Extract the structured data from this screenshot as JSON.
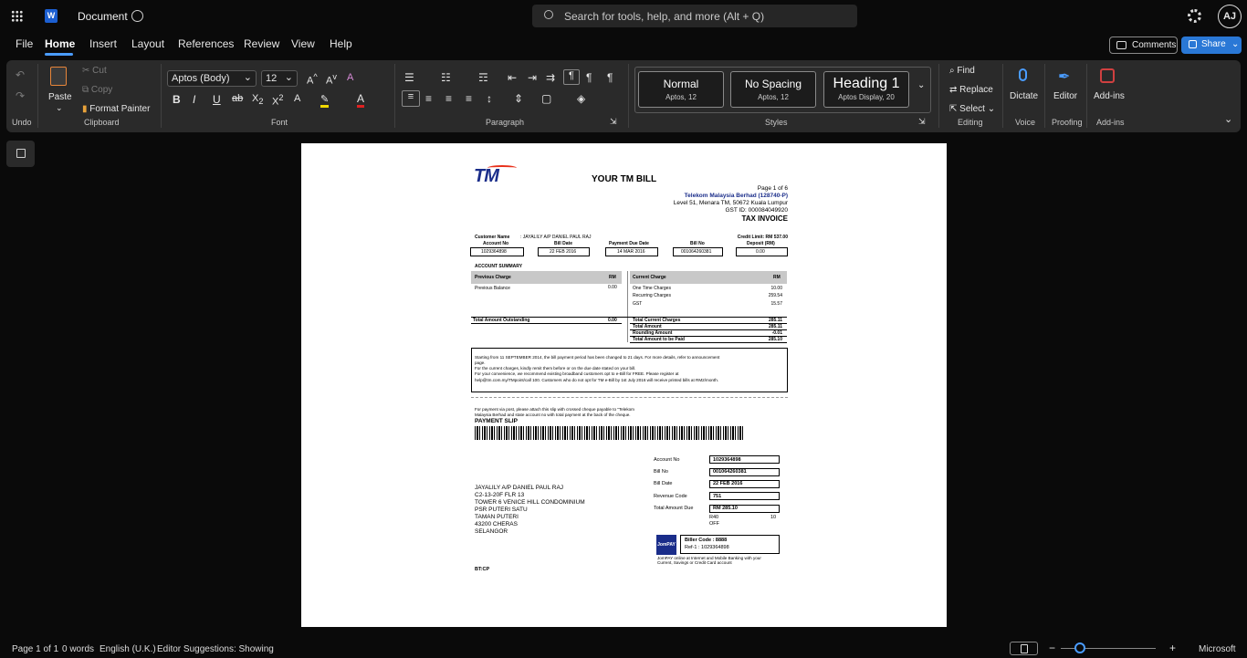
{
  "app": {
    "doc_title": "Document",
    "search_placeholder": "Search for tools, help, and more (Alt + Q)",
    "user_initials": "AJ"
  },
  "menu": [
    "File",
    "Home",
    "Insert",
    "Layout",
    "References",
    "Review",
    "View",
    "Help"
  ],
  "toolbar": {
    "comments": "Comments",
    "share": "Share"
  },
  "ribbon": {
    "undo_label": "Undo",
    "paste": "Paste",
    "cut": "Cut",
    "copy": "Copy",
    "format_painter": "Format Painter",
    "clipboard_label": "Clipboard",
    "font_name": "Aptos (Body)",
    "font_size": "12",
    "font_label": "Font",
    "paragraph_label": "Paragraph",
    "styles": [
      {
        "name": "Normal",
        "sub": "Aptos, 12"
      },
      {
        "name": "No Spacing",
        "sub": "Aptos, 12"
      },
      {
        "name": "Heading 1",
        "sub": "Aptos Display, 20"
      }
    ],
    "styles_label": "Styles",
    "find": "Find",
    "replace": "Replace",
    "select": "Select",
    "editing_label": "Editing",
    "dictate": "Dictate",
    "voice_label": "Voice",
    "editor": "Editor",
    "proofing_label": "Proofing",
    "addins": "Add-ins",
    "addins_label": "Add-ins"
  },
  "bill": {
    "logo": "TM",
    "title": "YOUR TM BILL",
    "page": "Page 1 of 6",
    "company": "Telekom Malaysia Berhad (128740-P)",
    "address": "Level 51, Menara TM, 50672 Kuala Lumpur",
    "gst_id": "GST ID: 000084049920",
    "tax_invoice": "TAX INVOICE",
    "customer_name_label": "Customer Name",
    "customer_name": ": JAYALILY A/P DANIEL PAUL RAJ",
    "credit_limit": "Credit Limit: RM 537.00",
    "headers": [
      "Account No",
      "Bill Date",
      "Payment Due Date",
      "Bill No",
      "Deposit (RM)"
    ],
    "values": [
      "1029364898",
      "22 FEB 2016",
      "14 MAR 2016",
      "001064260381",
      "0.00"
    ],
    "summary_title": "ACCOUNT SUMMARY",
    "prev_charge": "Previous Charge",
    "rm": "RM",
    "curr_charge": "Current Charge",
    "prev_balance": "Previous Balance",
    "prev_balance_val": "0.00",
    "charges": [
      {
        "label": "One Time Charges",
        "val": "10.00"
      },
      {
        "label": "Recurring Charges",
        "val": "259.54"
      },
      {
        "label": "GST",
        "val": "15.57"
      }
    ],
    "total_outstanding": "Total Amount Outstanding",
    "total_outstanding_val": "0.00",
    "totals": [
      {
        "label": "Total Current Charges",
        "val": "285.11"
      },
      {
        "label": "Total Amount",
        "val": "285.11"
      },
      {
        "label": "Rounding Amount",
        "val": "-0.01"
      },
      {
        "label": "Total Amount to be Paid",
        "val": "285.10"
      }
    ],
    "notice": [
      "Starting from 11 SEPTEMBER 2014, the bill payment period has been changed to 21 days. For more details, refer to announcement",
      "page.",
      "For the current charges, kindly remit them before or on the due date stated on your bill.",
      "For your convenience, we recommend existing broadband customers opt to e-Bill for FREE. Please register at",
      "help@tm.com.my/TMpoint/call 100. Customers who do not opt for TM e-Bill by 1st July 2016 will receive printed bills at RM2/month."
    ],
    "post_note": [
      "For payment via post, please attach this slip with crossed cheque payable to \"Telekom",
      "Malaysia Berhad and state account no with total payment at the back of the cheque."
    ],
    "slip_title": "PAYMENT SLIP",
    "slip_fields": [
      {
        "label": "Account No",
        "val": "1029364898"
      },
      {
        "label": "Bill No",
        "val": "001064260381"
      },
      {
        "label": "Bill Date",
        "val": "22 FEB 2016"
      },
      {
        "label": "Revenue Code",
        "val": "751"
      },
      {
        "label": "Total Amount Due",
        "val": "RM  285.10"
      }
    ],
    "r40": "R40",
    "off": "OFF",
    "ten": "10",
    "addr": [
      "JAYALILY A/P DANIEL PAUL RAJ",
      "C2-13-20F FLR 13",
      "TOWER 6 VENICE HILL CONDOMINIUM",
      "PSR PUTERI SATU",
      "TAMAN PUTERI",
      "43200 CHERAS",
      "SELANGOR"
    ],
    "biller": "Biller Code : 8888",
    "ref": "Ref-1 : 1029364898",
    "jompay_note": [
      "JomPAY online at Internet and Mobile Banking with your",
      "Current, Savings or Credit Card account"
    ],
    "btcp": "BT:CP"
  },
  "status": {
    "page": "Page 1 of 1",
    "words": "0 words",
    "lang": "English (U.K.)",
    "suggestions": "Editor Suggestions: Showing",
    "brand": "Microsoft"
  }
}
